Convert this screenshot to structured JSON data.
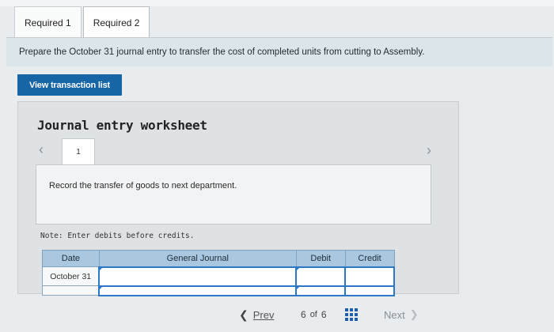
{
  "tabs": [
    {
      "label": "Required 1",
      "active": false
    },
    {
      "label": "Required 2",
      "active": true
    }
  ],
  "instruction": "Prepare the October 31 journal entry to transfer the cost of completed units from cutting to Assembly.",
  "view_transaction_list": "View transaction list",
  "worksheet": {
    "title": "Journal entry worksheet",
    "entry_tab": "1",
    "record_text": "Record the transfer of goods to next department.",
    "note": "Note: Enter debits before credits.",
    "columns": {
      "date": "Date",
      "general_journal": "General Journal",
      "debit": "Debit",
      "credit": "Credit"
    },
    "rows": [
      {
        "date": "October 31",
        "general_journal": "",
        "debit": "",
        "credit": ""
      }
    ]
  },
  "nav": {
    "prev": "Prev",
    "current": "6",
    "of": "of",
    "total": "6",
    "next": "Next"
  },
  "colors": {
    "accent": "#1565a7",
    "table_header": "#a9c7df",
    "input_border": "#2b78c6"
  }
}
